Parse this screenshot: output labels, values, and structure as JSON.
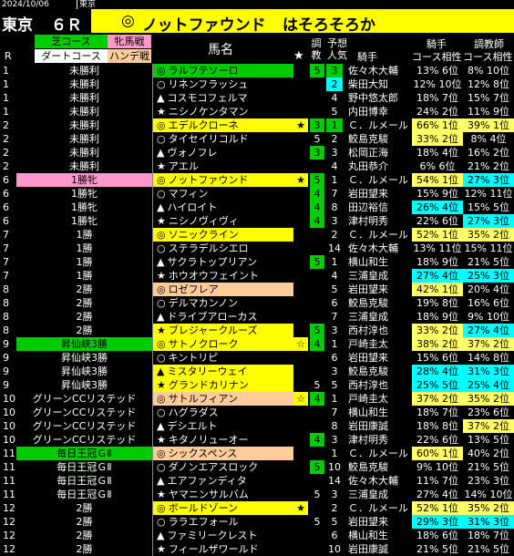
{
  "date": "2024/10/06",
  "venue_top": "東京",
  "venue": "東京",
  "race_no": "６Ｒ",
  "star_symbol": "◎",
  "pick_name": "ノットファウンド",
  "tagline": "はそろそろか",
  "headers": {
    "turf": "芝コース",
    "fillies": "牝馬戦",
    "dirt": "ダートコース",
    "handicap": "ハンデ戦",
    "r": "R",
    "horse": "馬名",
    "choukyou": "調教",
    "star": "★",
    "yosou": "予想",
    "ninki": "人気",
    "jockey": "騎手",
    "jockey_course": "騎手\nコース相性",
    "trainer_course": "調教師\nコース相性",
    "kishu1": "騎手",
    "kishu2": "コース相性",
    "chou1": "調教師",
    "chou2": "コース相性"
  },
  "colors": {
    "green": "#00cc00",
    "yellow": "#ffff00",
    "cyan": "#00ffff",
    "pink": "#ff99cc",
    "peach": "#ffcc99",
    "yellow_hl": "#ffff66",
    "teal": "#33cccc"
  },
  "rows": [
    {
      "r": "1",
      "cls": "未勝利",
      "mark": "◎",
      "name": "ラルフテソーロ",
      "hbg": "green",
      "star": "",
      "ch": "5",
      "chbg": "green",
      "pop": "3",
      "popbg": "green",
      "jk": "佐々木大輔",
      "jr": "13%",
      "jrr": "6位",
      "tr": "8%",
      "trr": "10位",
      "jrh": "",
      "trh": ""
    },
    {
      "r": "1",
      "cls": "未勝利",
      "mark": "○",
      "name": "リネンフラッシュ",
      "hbg": "",
      "star": "",
      "ch": "",
      "chbg": "",
      "pop": "2",
      "popbg": "cyan",
      "jk": "柴田大知",
      "jr": "12%",
      "jrr": "10位",
      "tr": "12%",
      "trr": "8位",
      "jrh": "",
      "trh": ""
    },
    {
      "r": "1",
      "cls": "未勝利",
      "mark": "▲",
      "name": "コスモコフェルマ",
      "hbg": "",
      "star": "",
      "ch": "",
      "chbg": "",
      "pop": "4",
      "popbg": "",
      "jk": "野中悠太郎",
      "jr": "18%",
      "jrr": "7位",
      "tr": "15%",
      "trr": "7位",
      "jrh": "",
      "trh": ""
    },
    {
      "r": "1",
      "cls": "未勝利",
      "mark": "★",
      "name": "ニシノケンタマン",
      "hbg": "",
      "star": "",
      "ch": "",
      "chbg": "",
      "pop": "5",
      "popbg": "",
      "jk": "内田博幸",
      "jr": "24%",
      "jrr": "2位",
      "tr": "11%",
      "trr": "9位",
      "jrh": "",
      "trh": ""
    },
    {
      "r": "2",
      "cls": "未勝利",
      "mark": "◎",
      "name": "エデルクローネ",
      "hbg": "yellow",
      "star": "★",
      "ch": "3",
      "chbg": "green",
      "pop": "1",
      "popbg": "green",
      "jk": "Ｃ．ルメール",
      "jr": "66%",
      "jrr": "1位",
      "tr": "39%",
      "trr": "1位",
      "jrh": "yellow_hl",
      "trh": "yellow_hl"
    },
    {
      "r": "2",
      "cls": "未勝利",
      "mark": "○",
      "name": "タイセイリコルド",
      "hbg": "",
      "star": "",
      "ch": "5",
      "chbg": "",
      "pop": "2",
      "popbg": "",
      "jk": "鮫島克駿",
      "jr": "33%",
      "jrr": "2位",
      "tr": "8%",
      "trr": "4位",
      "jrh": "yellow_hl",
      "trh": ""
    },
    {
      "r": "2",
      "cls": "未勝利",
      "mark": "▲",
      "name": "ヴォノフレ",
      "hbg": "",
      "star": "",
      "ch": "3",
      "chbg": "green",
      "pop": "3",
      "popbg": "",
      "jk": "松岡正海",
      "jr": "18%",
      "jrr": "4位",
      "tr": "16%",
      "trr": "2位",
      "jrh": "",
      "trh": ""
    },
    {
      "r": "2",
      "cls": "未勝利",
      "mark": "★",
      "name": "アエル",
      "hbg": "",
      "star": "",
      "ch": "",
      "chbg": "",
      "pop": "4",
      "popbg": "",
      "jk": "丸田恭介",
      "jr": "6%",
      "jrr": "6位",
      "tr": "21%",
      "trr": "2位",
      "jrh": "",
      "trh": ""
    },
    {
      "r": "6",
      "cls": "1勝牝",
      "clsbg": "pink",
      "mark": "◎",
      "name": "ノットファウンド",
      "hbg": "yellow",
      "star": "★",
      "ch": "5",
      "chbg": "green",
      "pop": "1",
      "popbg": "",
      "jk": "Ｃ．ルメール",
      "jr": "54%",
      "jrr": "1位",
      "tr": "27%",
      "trr": "3位",
      "jrh": "yellow_hl",
      "trh": "cyan"
    },
    {
      "r": "6",
      "cls": "1勝牝",
      "mark": "○",
      "name": "マフィン",
      "hbg": "",
      "star": "",
      "ch": "4",
      "chbg": "green",
      "pop": "7",
      "popbg": "",
      "jk": "岩田望来",
      "jr": "15%",
      "jrr": "9位",
      "tr": "12%",
      "trr": "11位",
      "jrh": "",
      "trh": ""
    },
    {
      "r": "6",
      "cls": "1勝牝",
      "mark": "▲",
      "name": "ハイロイト",
      "hbg": "",
      "star": "",
      "ch": "4",
      "chbg": "green",
      "pop": "8",
      "popbg": "",
      "jk": "田辺裕信",
      "jr": "26%",
      "jrr": "4位",
      "tr": "15%",
      "trr": "5位",
      "jrh": "cyan",
      "trh": ""
    },
    {
      "r": "6",
      "cls": "1勝牝",
      "mark": "★",
      "name": "ニシノヴィヴィ",
      "hbg": "",
      "star": "",
      "ch": "4",
      "chbg": "green",
      "pop": "3",
      "popbg": "",
      "jk": "津村明秀",
      "jr": "22%",
      "jrr": "6位",
      "tr": "27%",
      "trr": "3位",
      "jrh": "",
      "trh": "cyan"
    },
    {
      "r": "7",
      "cls": "1勝",
      "mark": "◎",
      "name": "ソニックライン",
      "hbg": "yellow",
      "star": "",
      "ch": "",
      "chbg": "",
      "pop": "2",
      "popbg": "",
      "jk": "Ｃ．ルメール",
      "jr": "52%",
      "jrr": "1位",
      "tr": "35%",
      "trr": "2位",
      "jrh": "yellow_hl",
      "trh": "yellow_hl"
    },
    {
      "r": "7",
      "cls": "1勝",
      "mark": "○",
      "name": "ステラデルシエロ",
      "hbg": "",
      "star": "",
      "ch": "",
      "chbg": "",
      "pop": "14",
      "popbg": "",
      "jk": "佐々木大輔",
      "jr": "13%",
      "jrr": "11位",
      "tr": "15%",
      "trr": "11位",
      "jrh": "",
      "trh": ""
    },
    {
      "r": "7",
      "cls": "1勝",
      "mark": "▲",
      "name": "サクラトップリアン",
      "hbg": "",
      "star": "",
      "ch": "5",
      "chbg": "green",
      "pop": "1",
      "popbg": "",
      "jk": "横山和生",
      "jr": "18%",
      "jrr": "9位",
      "tr": "21%",
      "trr": "5位",
      "jrh": "",
      "trh": ""
    },
    {
      "r": "7",
      "cls": "1勝",
      "mark": "★",
      "name": "ホウオウフェイント",
      "hbg": "",
      "star": "",
      "ch": "",
      "chbg": "",
      "pop": "4",
      "popbg": "",
      "jk": "三浦皇成",
      "jr": "27%",
      "jrr": "4位",
      "tr": "25%",
      "trr": "3位",
      "jrh": "cyan",
      "trh": "cyan"
    },
    {
      "r": "8",
      "cls": "2勝",
      "mark": "◎",
      "name": "ロゼフレア",
      "hbg": "peach",
      "star": "",
      "ch": "",
      "chbg": "",
      "pop": "5",
      "popbg": "",
      "jk": "岩田望来",
      "jr": "42%",
      "jrr": "1位",
      "tr": "20%",
      "trr": "4位",
      "jrh": "yellow_hl",
      "trh": ""
    },
    {
      "r": "8",
      "cls": "2勝",
      "mark": "○",
      "name": "デルマカンノン",
      "hbg": "",
      "star": "",
      "ch": "",
      "chbg": "",
      "pop": "6",
      "popbg": "",
      "jk": "鮫島克駿",
      "jr": "19%",
      "jrr": "8位",
      "tr": "16%",
      "trr": "6位",
      "jrh": "",
      "trh": ""
    },
    {
      "r": "8",
      "cls": "2勝",
      "mark": "▲",
      "name": "ドライブアローカス",
      "hbg": "",
      "star": "",
      "ch": "",
      "chbg": "",
      "pop": "7",
      "popbg": "",
      "jk": "三浦皇成",
      "jr": "18%",
      "jrr": "9位",
      "tr": "9%",
      "trr": "10位",
      "jrh": "",
      "trh": ""
    },
    {
      "r": "8",
      "cls": "2勝",
      "mark": "★",
      "name": "ブレジャークルーズ",
      "hbg": "yellow",
      "star": "",
      "ch": "5",
      "chbg": "green",
      "pop": "3",
      "popbg": "",
      "jk": "西村淳也",
      "jr": "33%",
      "jrr": "2位",
      "tr": "27%",
      "trr": "4位",
      "jrh": "yellow_hl",
      "trh": "cyan"
    },
    {
      "r": "9",
      "cls": "昇仙峡3勝",
      "clsbg": "green",
      "mark": "◎",
      "name": "サトノクローク",
      "hbg": "yellow",
      "star": "☆",
      "ch": "4",
      "chbg": "green",
      "pop": "1",
      "popbg": "",
      "jk": "戸崎圭太",
      "jr": "38%",
      "jrr": "2位",
      "tr": "37%",
      "trr": "2位",
      "jrh": "yellow_hl",
      "trh": "yellow_hl"
    },
    {
      "r": "9",
      "cls": "昇仙峡3勝",
      "mark": "○",
      "name": "キントリピ",
      "hbg": "",
      "star": "",
      "ch": "",
      "chbg": "",
      "pop": "6",
      "popbg": "",
      "jk": "岩田望来",
      "jr": "15%",
      "jrr": "6位",
      "tr": "14%",
      "trr": "8位",
      "jrh": "",
      "trh": ""
    },
    {
      "r": "9",
      "cls": "昇仙峡3勝",
      "mark": "▲",
      "name": "ミスタリーウェイ",
      "hbg": "yellow",
      "star": "",
      "ch": "",
      "chbg": "",
      "pop": "3",
      "popbg": "",
      "jk": "鮫島克駿",
      "jr": "28%",
      "jrr": "4位",
      "tr": "31%",
      "trr": "3位",
      "jrh": "cyan",
      "trh": "cyan"
    },
    {
      "r": "9",
      "cls": "昇仙峡3勝",
      "mark": "★",
      "name": "グランドカリナン",
      "hbg": "yellow",
      "star": "",
      "ch": "5",
      "chbg": "",
      "pop": "5",
      "popbg": "",
      "jk": "西村淳也",
      "jr": "25%",
      "jrr": "5位",
      "tr": "25%",
      "trr": "4位",
      "jrh": "cyan",
      "trh": "cyan"
    },
    {
      "r": "10",
      "cls": "グリーンCCリステッド",
      "mark": "◎",
      "name": "サトルフィアン",
      "hbg": "peach",
      "star": "☆",
      "ch": "4",
      "chbg": "green",
      "pop": "1",
      "popbg": "",
      "jk": "戸崎圭太",
      "jr": "37%",
      "jrr": "2位",
      "tr": "35%",
      "trr": "2位",
      "jrh": "yellow_hl",
      "trh": "yellow_hl"
    },
    {
      "r": "10",
      "cls": "グリーンCCリステッド",
      "mark": "○",
      "name": "ハグラダス",
      "hbg": "",
      "star": "",
      "ch": "",
      "chbg": "",
      "pop": "7",
      "popbg": "",
      "jk": "横山和生",
      "jr": "18%",
      "jrr": "7位",
      "tr": "23%",
      "trr": "6位",
      "jrh": "",
      "trh": ""
    },
    {
      "r": "10",
      "cls": "グリーンCCリステッド",
      "mark": "▲",
      "name": "デシエルト",
      "hbg": "",
      "star": "",
      "ch": "",
      "chbg": "",
      "pop": "8",
      "popbg": "",
      "jk": "岩田康誠",
      "jr": "18%",
      "jrr": "8位",
      "tr": "37%",
      "trr": "2位",
      "jrh": "",
      "trh": "yellow_hl"
    },
    {
      "r": "10",
      "cls": "グリーンCCリステッド",
      "mark": "★",
      "name": "キタノリューオー",
      "hbg": "",
      "star": "",
      "ch": "4",
      "chbg": "green",
      "pop": "3",
      "popbg": "",
      "jk": "津村明秀",
      "jr": "22%",
      "jrr": "6位",
      "tr": "13%",
      "trr": "5位",
      "jrh": "",
      "trh": ""
    },
    {
      "r": "11",
      "cls": "毎日王冠ＧⅡ",
      "clsbg": "green",
      "mark": "◎",
      "name": "シックスペンス",
      "hbg": "peach",
      "star": "",
      "ch": "",
      "chbg": "",
      "pop": "1",
      "popbg": "",
      "jk": "Ｃ．ルメール",
      "jr": "60%",
      "jrr": "1位",
      "tr": "40%",
      "trr": "2位",
      "jrh": "yellow_hl",
      "trh": ""
    },
    {
      "r": "11",
      "cls": "毎日王冠ＧⅡ",
      "mark": "○",
      "name": "ダノンエアスロック",
      "hbg": "",
      "star": "",
      "ch": "5",
      "chbg": "green",
      "pop": "10",
      "popbg": "",
      "jk": "鮫島克駿",
      "jr": "9%",
      "jrr": "10位",
      "tr": "21%",
      "trr": "5位",
      "jrh": "",
      "trh": ""
    },
    {
      "r": "11",
      "cls": "毎日王冠ＧⅡ",
      "mark": "▲",
      "name": "エアファンディタ",
      "hbg": "",
      "star": "",
      "ch": "",
      "chbg": "",
      "pop": "14",
      "popbg": "",
      "jk": "佐々木大輔",
      "jr": "11%",
      "jrr": "7位",
      "tr": "23%",
      "trr": "3位",
      "jrh": "",
      "trh": ""
    },
    {
      "r": "11",
      "cls": "毎日王冠ＧⅡ",
      "mark": "★",
      "name": "ヤマニンサルバム",
      "hbg": "",
      "star": "",
      "ch": "5",
      "chbg": "",
      "pop": "3",
      "popbg": "",
      "jk": "三浦皇成",
      "jr": "27%",
      "jrr": "4位",
      "tr": "14%",
      "trr": "10位",
      "jrh": "",
      "trh": ""
    },
    {
      "r": "12",
      "cls": "2勝",
      "mark": "◎",
      "name": "ボールドゾーン",
      "hbg": "yellow",
      "star": "★",
      "ch": "",
      "chbg": "",
      "pop": "2",
      "popbg": "",
      "jk": "Ｃ．ルメール",
      "jr": "52%",
      "jrr": "1位",
      "tr": "35%",
      "trr": "2位",
      "jrh": "yellow_hl",
      "trh": "yellow_hl"
    },
    {
      "r": "12",
      "cls": "2勝",
      "mark": "○",
      "name": "ララエフォール",
      "hbg": "",
      "star": "",
      "ch": "5",
      "chbg": "",
      "pop": "5",
      "popbg": "",
      "jk": "岩田望来",
      "jr": "29%",
      "jrr": "3位",
      "tr": "31%",
      "trr": "3位",
      "jrh": "cyan",
      "trh": "cyan"
    },
    {
      "r": "12",
      "cls": "2勝",
      "mark": "▲",
      "name": "ファミリークレスト",
      "hbg": "",
      "star": "",
      "ch": "",
      "chbg": "",
      "pop": "6",
      "popbg": "",
      "jk": "横山和生",
      "jr": "18%",
      "jrr": "6位",
      "tr": "18%",
      "trr": "7位",
      "jrh": "",
      "trh": ""
    },
    {
      "r": "12",
      "cls": "2勝",
      "mark": "★",
      "name": "フィールザワールド",
      "hbg": "",
      "star": "",
      "ch": "",
      "chbg": "",
      "pop": "10",
      "popbg": "",
      "jk": "岩田康誠",
      "jr": "21%",
      "jrr": "5位",
      "tr": "21%",
      "trr": "5位",
      "jrh": "",
      "trh": ""
    }
  ]
}
